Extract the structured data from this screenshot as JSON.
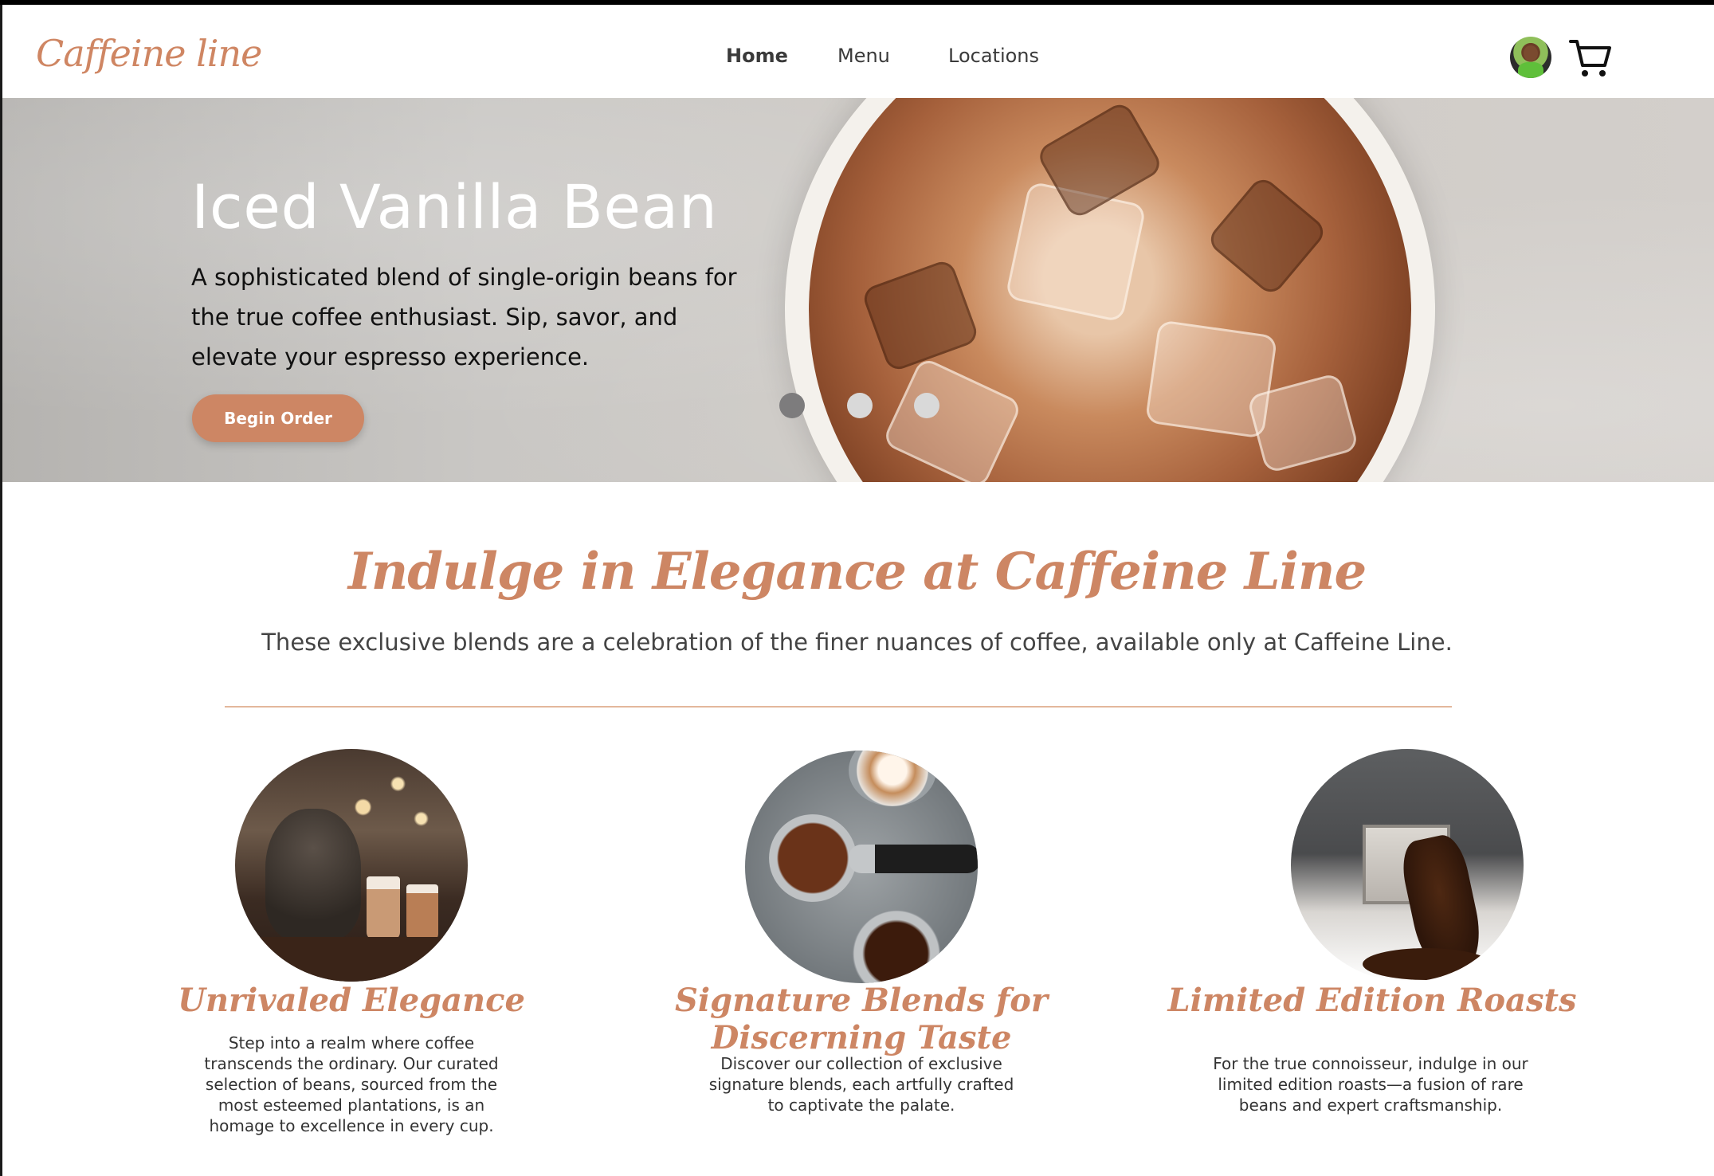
{
  "brand": {
    "logo": "Caffeine line",
    "accent_color": "#cd8664"
  },
  "nav": {
    "items": [
      {
        "label": "Home",
        "active": true
      },
      {
        "label": "Menu",
        "active": false
      },
      {
        "label": "Locations",
        "active": false
      }
    ],
    "avatar_icon": "user-avatar",
    "cart_icon": "shopping-cart-icon"
  },
  "hero": {
    "title": "Iced Vanilla Bean",
    "description": "A sophisticated blend of single-origin beans for the true coffee enthusiast. Sip, savor, and elevate your espresso experience.",
    "button_label": "Begin Order",
    "slides": {
      "count": 3,
      "active_index": 0
    }
  },
  "intro": {
    "title": "Indulge in Elegance at Caffeine Line",
    "subtitle": "These exclusive blends are a celebration of the finer nuances of coffee, available only at Caffeine Line."
  },
  "features": [
    {
      "title": "Unrivaled Elegance",
      "text": "Step into a realm where coffee transcends the ordinary. Our curated selection of beans, sourced from the most esteemed plantations, is an homage to excellence in every cup."
    },
    {
      "title": "Signature Blends for Discerning Taste",
      "text": "Discover our collection of exclusive signature blends, each artfully crafted to captivate the palate."
    },
    {
      "title": "Limited Edition Roasts",
      "text": "For the true connoisseur, indulge in our limited edition roasts—a fusion of rare beans and expert craftsmanship."
    }
  ]
}
